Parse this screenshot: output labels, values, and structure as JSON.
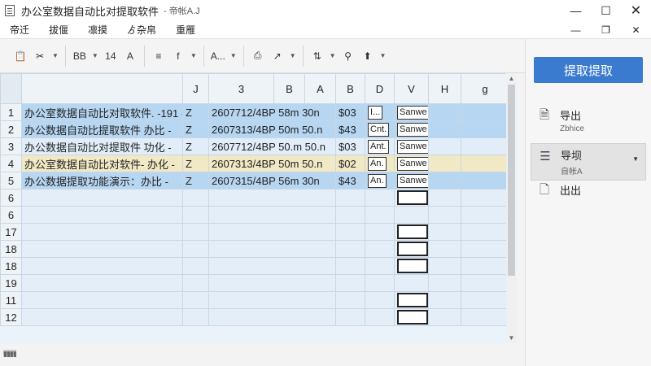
{
  "window": {
    "title": "办公室数据自动比对提取软件",
    "subtitle": "- 帝帐A.J",
    "minimize": "—",
    "maximize": "☐",
    "close": "✕"
  },
  "menu": {
    "items": [
      "帝迁",
      "拔偃",
      "凛摸",
      "ゟ杂帛",
      "重雁"
    ],
    "restore_inner": "❐",
    "restore_min": "—",
    "restore_close": "✕"
  },
  "toolbar": {
    "paste_icon": "📋",
    "cut_icon": "✂",
    "bold_label": "BB",
    "font_size_label": "14",
    "font_label": "A",
    "align_label": "≡",
    "format_label": "f",
    "table_label": "A...",
    "print_label": "⎙",
    "filter_label": "↗",
    "sort_label": "⇅",
    "search_label": "⚲",
    "export_label": "⬆"
  },
  "grid": {
    "columns": [
      "J",
      "3",
      "B",
      "A",
      "B",
      "D",
      "V",
      "H",
      "g"
    ],
    "rows": [
      {
        "num": "1",
        "style": "row-blue",
        "name": "办公室数据自动比对取软件.  -191 -",
        "z": "Z",
        "code": "2607712/4BP 58m 30n",
        "price": "$03",
        "tag": "I...",
        "sample": "Sanwe"
      },
      {
        "num": "2",
        "style": "row-blue",
        "name": "办公数据自动比提取软件  办比 -",
        "z": "Z",
        "code": "2607313/4BP 50m 50.n",
        "price": "$43",
        "tag": "Cnt.",
        "sample": "Sanwe"
      },
      {
        "num": "3",
        "style": "row-light",
        "name": "办公数据自动比对提取件  功化 -",
        "z": "Z",
        "code": "2607712/4BP 50.m 50.n",
        "price": "$03",
        "tag": "Ant.",
        "sample": "Sanwe"
      },
      {
        "num": "4",
        "style": "row-yellow",
        "name": "办公室数据自动比对软件-  办化 -",
        "z": "Z",
        "code": "2607313/4BP 50m 50.n",
        "price": "$02",
        "tag": "An.",
        "sample": "Sanwe"
      },
      {
        "num": "5",
        "style": "row-blue",
        "name": "办公数据提取功能演示：办比 -",
        "z": "Z",
        "code": "2607315/4BP 56m 30n",
        "price": "$43",
        "tag": "An.",
        "sample": "Sanwe"
      },
      {
        "num": "6",
        "style": "row-empty"
      },
      {
        "num": "6",
        "style": "row-empty"
      },
      {
        "num": "17",
        "style": "row-empty"
      },
      {
        "num": "18",
        "style": "row-empty"
      },
      {
        "num": "18",
        "style": "row-empty"
      },
      {
        "num": "19",
        "style": "row-empty"
      },
      {
        "num": "11",
        "style": "row-empty"
      },
      {
        "num": "12",
        "style": "row-empty"
      }
    ]
  },
  "side": {
    "extract_button": "提取提取",
    "export_label": "导出",
    "export_sub": "Zbhice",
    "import_label": "导坝",
    "import_sub": "自帐A",
    "out_label": "出出"
  },
  "status": {
    "indicator": "▮▮▮▮"
  }
}
